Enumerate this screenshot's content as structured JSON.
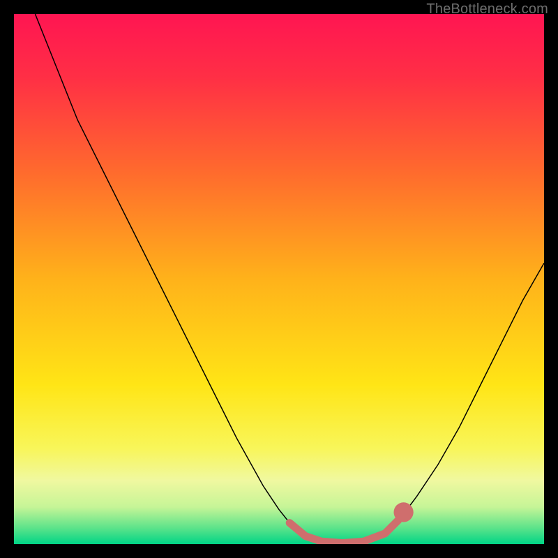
{
  "watermark": "TheBottleneck.com",
  "chart_data": {
    "type": "line",
    "title": "",
    "xlabel": "",
    "ylabel": "",
    "xlim": [
      0,
      100
    ],
    "ylim": [
      0,
      100
    ],
    "grid": false,
    "legend": false,
    "background_gradient": {
      "stops": [
        {
          "offset": 0.0,
          "color": "#ff1552"
        },
        {
          "offset": 0.12,
          "color": "#ff2f45"
        },
        {
          "offset": 0.3,
          "color": "#ff6b2d"
        },
        {
          "offset": 0.5,
          "color": "#ffb21a"
        },
        {
          "offset": 0.7,
          "color": "#ffe516"
        },
        {
          "offset": 0.82,
          "color": "#f8f65a"
        },
        {
          "offset": 0.88,
          "color": "#f0f8a0"
        },
        {
          "offset": 0.93,
          "color": "#c6f597"
        },
        {
          "offset": 0.97,
          "color": "#5be38a"
        },
        {
          "offset": 1.0,
          "color": "#00d586"
        }
      ]
    },
    "series": [
      {
        "name": "bottleneck-curve",
        "stroke": "#000000",
        "stroke_width": 1.5,
        "points": [
          {
            "x": 4.0,
            "y": 100.0
          },
          {
            "x": 8.0,
            "y": 90.0
          },
          {
            "x": 12.0,
            "y": 80.0
          },
          {
            "x": 17.0,
            "y": 70.0
          },
          {
            "x": 22.0,
            "y": 60.0
          },
          {
            "x": 27.0,
            "y": 50.0
          },
          {
            "x": 32.0,
            "y": 40.0
          },
          {
            "x": 37.0,
            "y": 30.0
          },
          {
            "x": 42.0,
            "y": 20.0
          },
          {
            "x": 47.0,
            "y": 11.0
          },
          {
            "x": 50.0,
            "y": 6.5
          },
          {
            "x": 52.0,
            "y": 4.0
          },
          {
            "x": 55.0,
            "y": 1.5
          },
          {
            "x": 58.0,
            "y": 0.4
          },
          {
            "x": 62.0,
            "y": 0.0
          },
          {
            "x": 66.0,
            "y": 0.4
          },
          {
            "x": 70.0,
            "y": 2.0
          },
          {
            "x": 73.0,
            "y": 5.0
          },
          {
            "x": 76.0,
            "y": 9.0
          },
          {
            "x": 80.0,
            "y": 15.0
          },
          {
            "x": 84.0,
            "y": 22.0
          },
          {
            "x": 88.0,
            "y": 30.0
          },
          {
            "x": 92.0,
            "y": 38.0
          },
          {
            "x": 96.0,
            "y": 46.0
          },
          {
            "x": 100.0,
            "y": 53.0
          }
        ]
      },
      {
        "name": "optimal-band",
        "stroke": "#cf6e6d",
        "stroke_width": 11,
        "linecap": "round",
        "points": [
          {
            "x": 52.0,
            "y": 4.0
          },
          {
            "x": 55.0,
            "y": 1.5
          },
          {
            "x": 58.0,
            "y": 0.5
          },
          {
            "x": 62.0,
            "y": 0.2
          },
          {
            "x": 66.0,
            "y": 0.5
          },
          {
            "x": 70.0,
            "y": 2.0
          },
          {
            "x": 72.5,
            "y": 4.5
          }
        ]
      }
    ],
    "markers": [
      {
        "name": "optimal-dot",
        "x": 73.5,
        "y": 6.0,
        "r": 1.2,
        "fill": "#cf6e6d"
      }
    ]
  }
}
